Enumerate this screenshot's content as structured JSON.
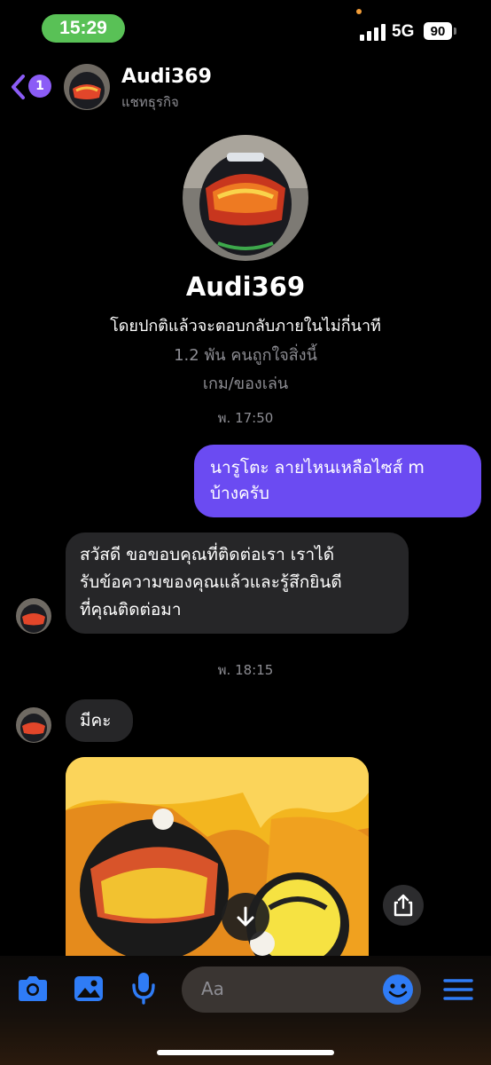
{
  "status_bar": {
    "time": "15:29",
    "network": "5G",
    "battery": "90"
  },
  "header": {
    "back_badge": "1",
    "name": "Audi369",
    "subtitle": "แชทธุรกิจ"
  },
  "profile": {
    "name": "Audi369",
    "response_note": "โดยปกติแล้วจะตอบกลับภายในไม่กี่นาที",
    "likes": "1.2 พัน คนถูกใจสิ่งนี้",
    "category": "เกม/ของเล่น"
  },
  "messages": [
    {
      "type": "timestamp",
      "text": "พ. 17:50"
    },
    {
      "type": "outgoing",
      "text": "นารูโตะ ลายไหนเหลือไซส์ m\nบ้างครับ"
    },
    {
      "type": "incoming",
      "text": "สวัสดี ขอขอบคุณที่ติดต่อเรา เราได้\nรับข้อความของคุณแล้วและรู้สึกยินดี\nที่คุณติดต่อมา"
    },
    {
      "type": "timestamp",
      "text": "พ. 18:15"
    },
    {
      "type": "incoming",
      "text": "มีคะ"
    },
    {
      "type": "image",
      "text": ""
    }
  ],
  "composer": {
    "placeholder": "Aa",
    "icons": [
      "camera-icon",
      "gallery-icon",
      "microphone-icon",
      "emoji-icon",
      "menu-icon"
    ]
  },
  "colors": {
    "status_time_bg": "#59c156",
    "accent_purple": "#6b4bf2",
    "incoming_bubble": "#262628",
    "icon_blue": "#2f7cf6"
  }
}
